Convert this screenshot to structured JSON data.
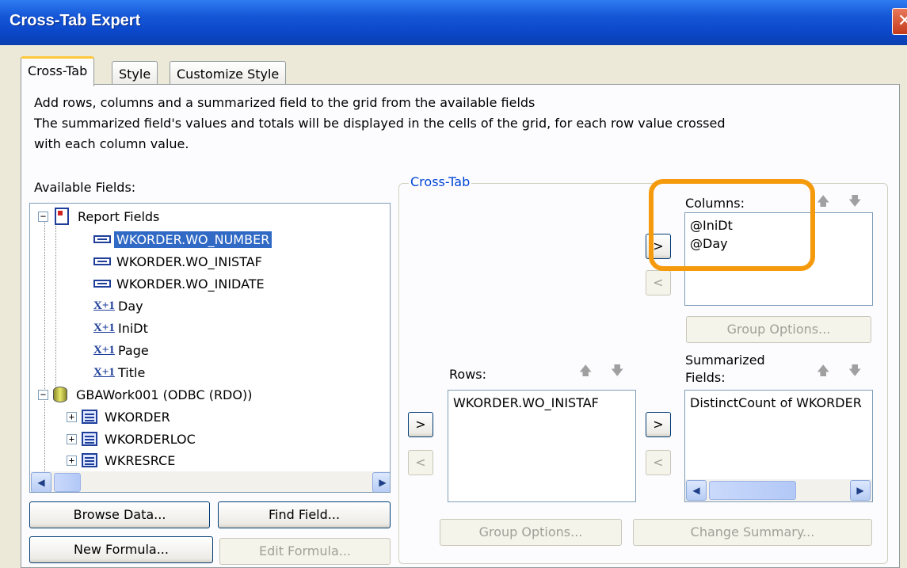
{
  "window": {
    "title": "Cross-Tab Expert",
    "close": "✕"
  },
  "tabs": [
    "Cross-Tab",
    "Style",
    "Customize Style"
  ],
  "description": [
    "Add rows, columns and a summarized field to the grid from the available fields",
    "The summarized field's values and totals will be displayed in the cells of the grid, for each row value crossed",
    "with each column value."
  ],
  "available": {
    "label": "Available Fields:",
    "items": [
      {
        "label": "Report Fields",
        "icon": "report-icon",
        "expander": "−"
      },
      {
        "label": "WKORDER.WO_NUMBER",
        "icon": "field-icon",
        "selected": true
      },
      {
        "label": "WKORDER.WO_INISTAF",
        "icon": "field-icon"
      },
      {
        "label": "WKORDER.WO_INIDATE",
        "icon": "field-icon"
      },
      {
        "label": "Day",
        "icon": "formula-icon"
      },
      {
        "label": "IniDt",
        "icon": "formula-icon"
      },
      {
        "label": "Page",
        "icon": "formula-icon"
      },
      {
        "label": "Title",
        "icon": "formula-icon"
      },
      {
        "label": "GBAWork001 (ODBC (RDO))",
        "icon": "database-icon",
        "expander": "−"
      },
      {
        "label": "WKORDER",
        "icon": "table-icon",
        "expander": "+"
      },
      {
        "label": "WKORDERLOC",
        "icon": "table-icon",
        "expander": "+"
      },
      {
        "label": "WKRESRCE",
        "icon": "table-icon",
        "expander": "+"
      }
    ],
    "formula_glyph": "X+1"
  },
  "buttons": {
    "browse_data": "Browse Data...",
    "find_field": "Find Field...",
    "new_formula": "New Formula...",
    "edit_formula": "Edit Formula...",
    "add": ">",
    "remove": "<",
    "group_options": "Group Options...",
    "change_summary": "Change Summary..."
  },
  "crosstab": {
    "legend": "Cross-Tab",
    "columns_label": "Columns:",
    "columns": [
      "@IniDt",
      "@Day"
    ],
    "rows_label": "Rows:",
    "rows": [
      "WKORDER.WO_INISTAF"
    ],
    "summarized_label_1": "Summarized",
    "summarized_label_2": "Fields:",
    "summarized": [
      "DistinctCount of WKORDER"
    ]
  },
  "glyphs": {
    "up": "🡅",
    "down": "🡇",
    "scroll_up": "▲",
    "scroll_down": "▼",
    "scroll_left": "◀",
    "scroll_right": "▶"
  },
  "colors": {
    "highlight": "#f59a0c",
    "selection": "#316ac5",
    "title_bar": "#0b48c9"
  }
}
